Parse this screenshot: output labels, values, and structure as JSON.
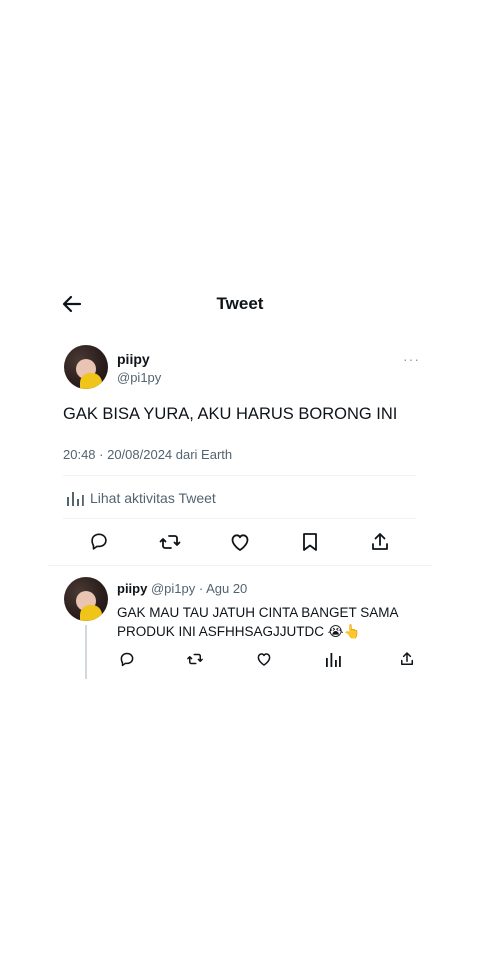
{
  "header": {
    "title": "Tweet",
    "back_icon": "arrow-left-icon"
  },
  "tweet": {
    "display_name": "piipy",
    "handle": "@pi1py",
    "more": "···",
    "text": "GAK BISA YURA, AKU HARUS BORONG INI",
    "meta": "20:48 · 20/08/2024 dari Earth",
    "analytics_label": "Lihat aktivitas Tweet",
    "actions": [
      "reply-icon",
      "retweet-icon",
      "like-icon",
      "bookmark-icon",
      "share-icon"
    ]
  },
  "reply": {
    "display_name": "piipy",
    "handle_time": "@pi1py · Agu 20",
    "text": "GAK MAU TAU JATUH CINTA BANGET SAMA PRODUK INI ASFHHSAGJJUTDC 😭👆",
    "actions": [
      "reply-icon",
      "retweet-icon",
      "like-icon",
      "analytics-icon",
      "share-icon"
    ]
  },
  "colors": {
    "text_primary": "#0f1419",
    "text_secondary": "#536471",
    "divider": "#eff3f4",
    "thread_line": "#cfd9de"
  }
}
